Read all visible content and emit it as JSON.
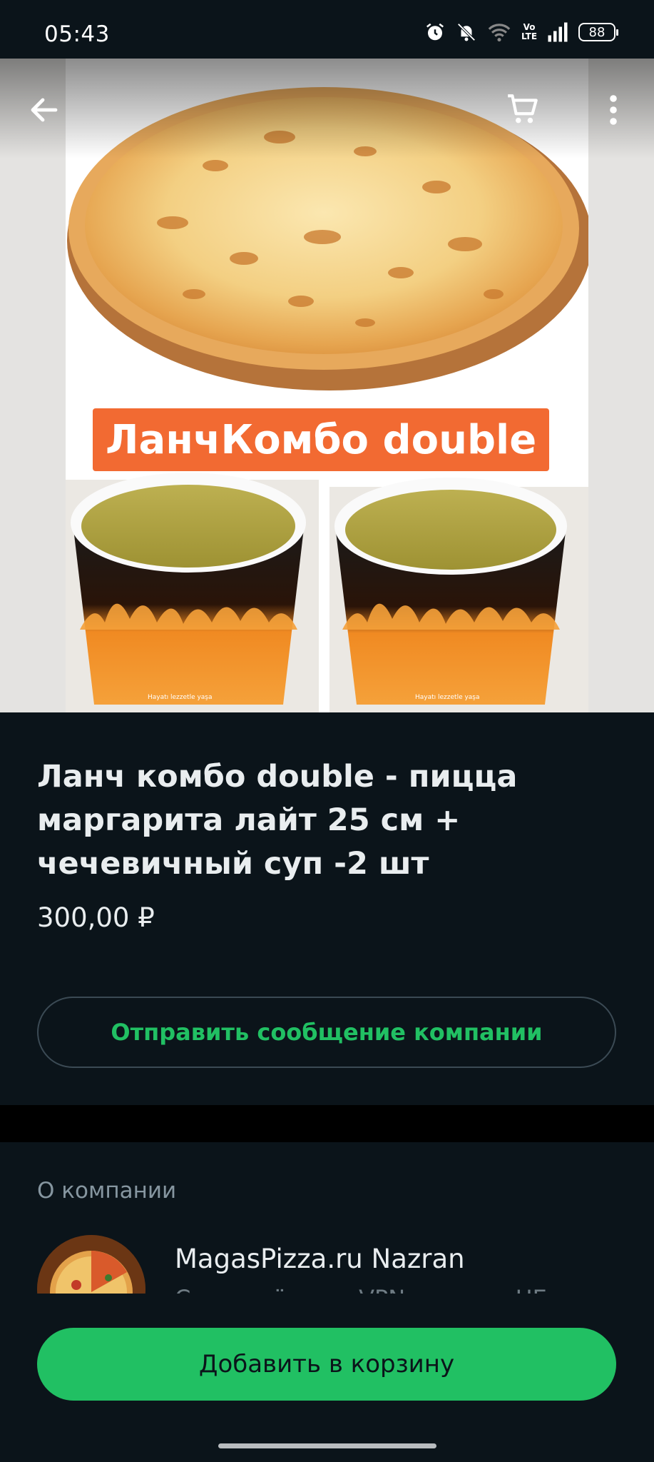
{
  "status_bar": {
    "time": "05:43",
    "battery": "88",
    "network": "Vo LTE",
    "icons": [
      "alarm-icon",
      "mute-icon",
      "wifi-icon",
      "volte-icon",
      "signal-icon",
      "battery-icon"
    ]
  },
  "header": {
    "icons": [
      "back-arrow-icon",
      "cart-icon",
      "more-vertical-icon"
    ]
  },
  "hero": {
    "banner_text": "ЛанчКомбо double",
    "bowl_label": "Hayatı lezzetle yaşa"
  },
  "product": {
    "title": "Ланч комбо double - пицца маргарита лайт 25 см + чечевичный суп -2 шт",
    "price": "300,00 ₽",
    "message_button": "Отправить сообщение компании"
  },
  "company": {
    "section_label": "О компании",
    "name": "MagasPizza.ru Nazran",
    "description": "С включённым VPN каталог НЕ"
  },
  "actions": {
    "add_to_cart": "Добавить в корзину"
  },
  "colors": {
    "background": "#0b141a",
    "accent": "#21c063",
    "banner": "#f26a32"
  }
}
